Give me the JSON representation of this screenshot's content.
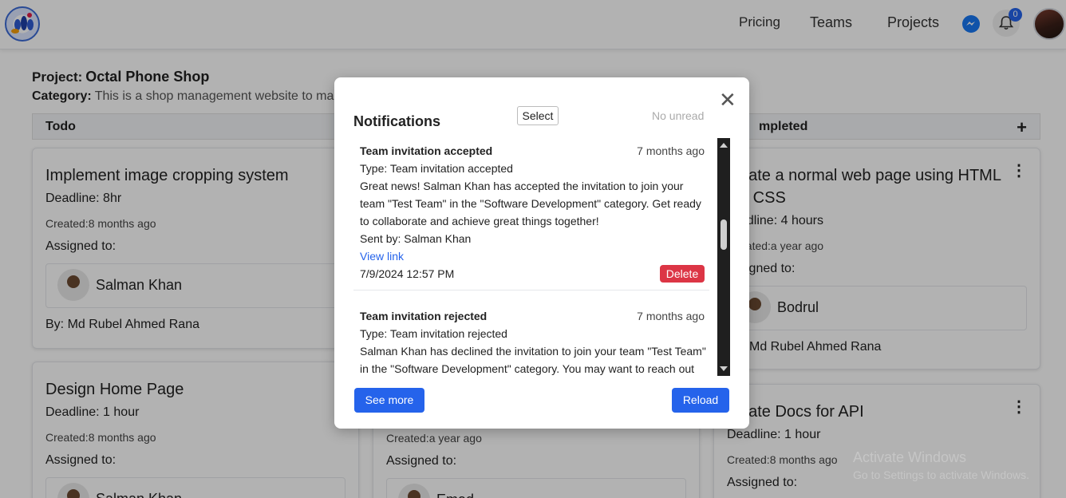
{
  "navbar": {
    "logo_icon": "team-logo-icon",
    "links": [
      "Pricing",
      "Teams",
      "Projects"
    ],
    "messenger_icon": "messenger-icon",
    "bell_icon": "bell-icon",
    "notification_count": "0",
    "avatar_icon": "user-avatar"
  },
  "project": {
    "label": "Project:",
    "name": "Octal Phone Shop",
    "category_label": "Category:",
    "category_value": "This is a shop management website to ma"
  },
  "columns": {
    "todo": {
      "title": "Todo",
      "add_icon": "plus-icon"
    },
    "completed": {
      "title": "mpleted",
      "add_icon": "plus-icon"
    }
  },
  "cards": {
    "todo1": {
      "title": "Implement image cropping system",
      "deadline": "Deadline: 8hr",
      "created": "Created:8 months ago",
      "assigned": "Assigned to:",
      "assignee": "Salman Khan",
      "by": "By: Md Rubel Ahmed Rana"
    },
    "todo2": {
      "title": "Design Home Page",
      "deadline": "Deadline: 1 hour",
      "created": "Created:8 months ago",
      "assigned": "Assigned to:",
      "assignee": "Salman Khan"
    },
    "mid2": {
      "created": "Created:a year ago",
      "assigned": "Assigned to:",
      "assignee": "Emad"
    },
    "comp1": {
      "title_line1": "eate a normal web page using HTML",
      "title_line2": "d CSS",
      "deadline": "adline: 4 hours",
      "created": "eated:a year ago",
      "assigned": "signed to:",
      "assignee": "Bodrul",
      "by": "Md Rubel Ahmed Rana"
    },
    "comp2": {
      "title": "eate Docs for API",
      "deadline": "Deadline: 1 hour",
      "created": "Created:8 months ago",
      "assigned": "Assigned to:"
    }
  },
  "modal": {
    "title": "Notifications",
    "select_label": "Select",
    "no_unread": "No unread",
    "close_icon": "close-icon",
    "see_more_label": "See more",
    "reload_label": "Reload",
    "notifications": [
      {
        "title": "Team invitation accepted",
        "time": "7 months ago",
        "type": "Type: Team invitation accepted",
        "line1": "Great news! Salman Khan has accepted the invitation to join your",
        "line2": "team \"Test Team\" in the \"Software Development\" category. Get ready",
        "line3": "to collaborate and achieve great things together!",
        "sent_by": "Sent by: Salman Khan",
        "link_label": "View link",
        "date": "7/9/2024 12:57 PM",
        "delete_label": "Delete"
      },
      {
        "title": "Team invitation rejected",
        "time": "7 months ago",
        "type": "Type: Team invitation rejected",
        "line1": "Salman Khan has declined the invitation to join your team \"Test Team\"",
        "line2": "in the \"Software Development\" category. You may want to reach out"
      }
    ]
  },
  "watermark": {
    "line1": "Activate Windows",
    "line2": "Go to Settings to activate Windows."
  }
}
